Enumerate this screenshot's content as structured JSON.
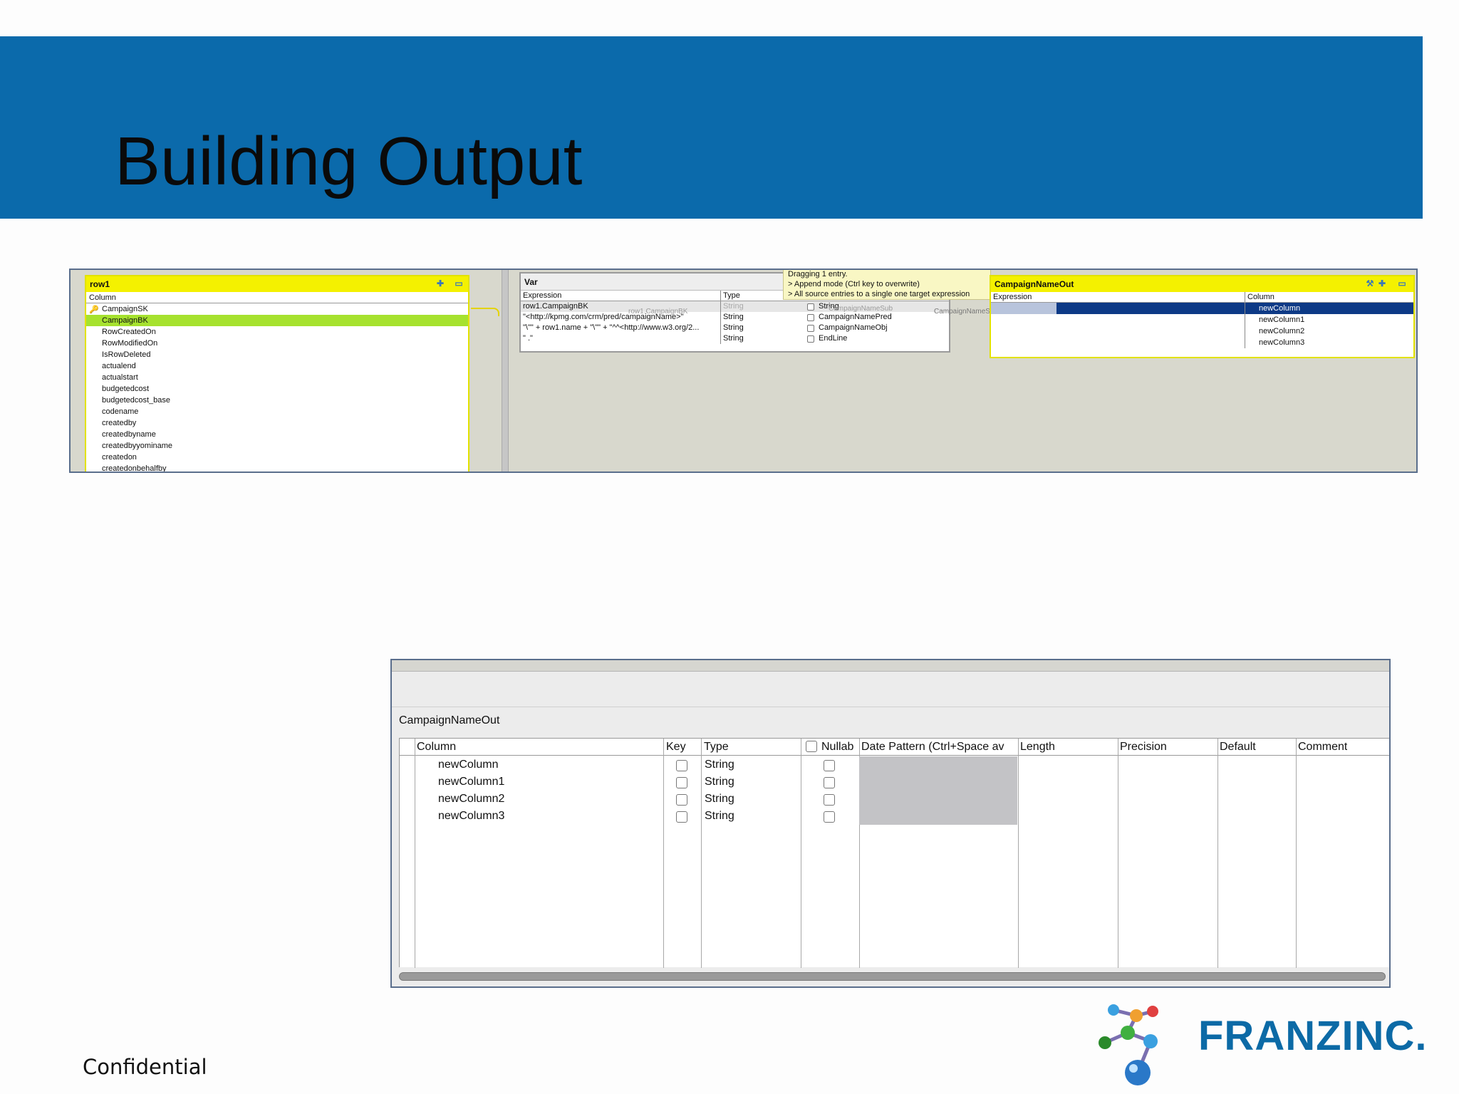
{
  "slide": {
    "title": "Building Output",
    "footer": "Confidential",
    "logo_text": "FRANZINC.",
    "brand_color": "#0b6aab"
  },
  "mapper": {
    "input": {
      "name": "row1",
      "column_header": "Column",
      "rows": [
        "CampaignSK",
        "CampaignBK",
        "RowCreatedOn",
        "RowModifiedOn",
        "IsRowDeleted",
        "actualend",
        "actualstart",
        "budgetedcost",
        "budgetedcost_base",
        "codename",
        "createdby",
        "createdbyname",
        "createdbyyominame",
        "createdon",
        "createdonbehalfby"
      ],
      "selected": "CampaignBK",
      "key_row": "CampaignSK"
    },
    "var": {
      "name": "Var",
      "headers": {
        "expression": "Expression",
        "type": "Type"
      },
      "rows": [
        {
          "expression": "row1.CampaignBK",
          "type": "String",
          "name": "String"
        },
        {
          "expression": "\"<http://kpmg.com/crm/pred/campaignName>\"",
          "type": "String",
          "name": "CampaignNamePred"
        },
        {
          "expression": "\"\\\"\" + row1.name + \"\\\"\" + \"^^<http://www.w3.org/2...",
          "type": "String",
          "name": "CampaignNameObj"
        },
        {
          "expression": "\" .\"",
          "type": "String",
          "name": "EndLine"
        }
      ],
      "ghost_expression": "row1.CampaignBK",
      "ghost_name": "CampaignNameSub",
      "ghost_output": "CampaignNameSub"
    },
    "tooltip": {
      "line1": "Dragging 1 entry.",
      "line2": "> Append mode (Ctrl key to overwrite)",
      "line3": "> All source entries to a single one target expression"
    },
    "output": {
      "name": "CampaignNameOut",
      "headers": {
        "expression": "Expression",
        "column": "Column"
      },
      "rows": [
        "newColumn",
        "newColumn1",
        "newColumn2",
        "newColumn3"
      ]
    }
  },
  "schema": {
    "title": "CampaignNameOut",
    "headers": {
      "column": "Column",
      "key": "Key",
      "type": "Type",
      "nullable": "Nullab",
      "date_pattern": "Date Pattern (Ctrl+Space av",
      "length": "Length",
      "precision": "Precision",
      "default": "Default",
      "comment": "Comment"
    },
    "rows": [
      {
        "column": "newColumn",
        "type": "String"
      },
      {
        "column": "newColumn1",
        "type": "String"
      },
      {
        "column": "newColumn2",
        "type": "String"
      },
      {
        "column": "newColumn3",
        "type": "String"
      }
    ]
  }
}
